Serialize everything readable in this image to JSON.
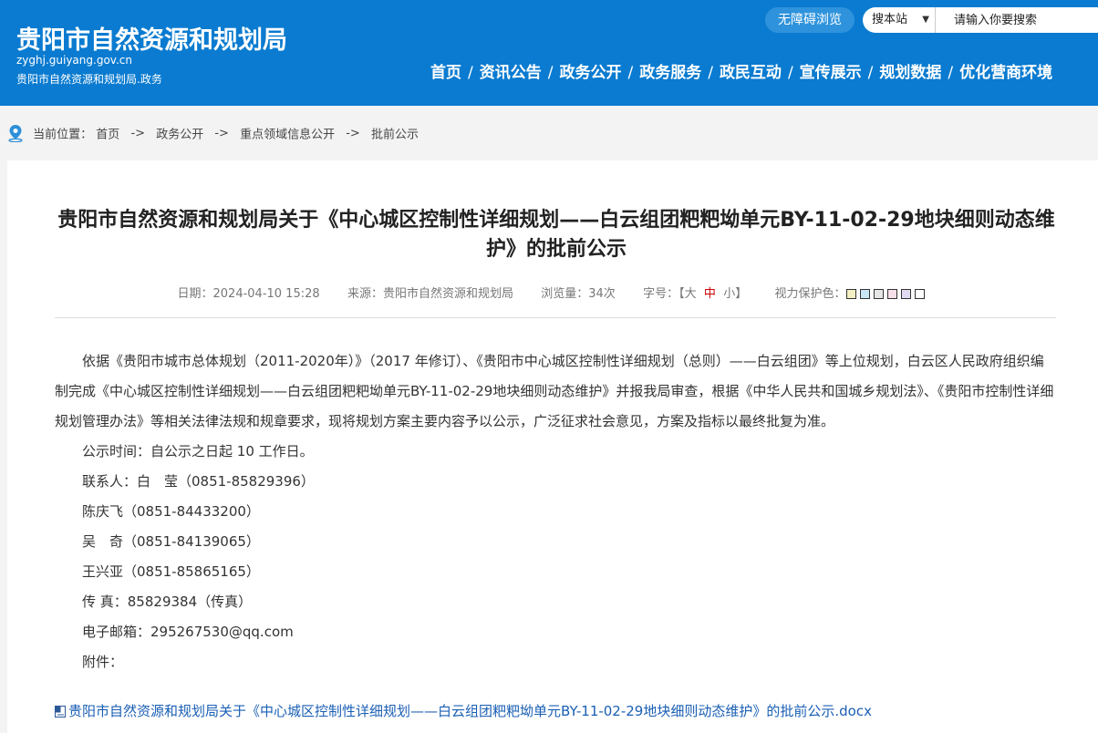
{
  "header": {
    "site_name": "贵阳市自然资源和规划局",
    "domain": "zyghj.guiyang.gov.cn",
    "suffix": "贵阳市自然资源和规划局.政务",
    "accessibility_label": "无障碍浏览",
    "search": {
      "scope": "搜本站",
      "placeholder": "请输入你要搜索"
    },
    "nav": [
      "首页",
      "资讯公告",
      "政务公开",
      "政务服务",
      "政民互动",
      "宣传展示",
      "规划数据",
      "优化营商环境"
    ],
    "colors": {
      "header_bg": "#0a7bd0",
      "accessibility_bg": "#2e93dc"
    }
  },
  "breadcrumb": {
    "prefix": "当前位置：",
    "items": [
      "首页",
      "政务公开",
      "重点领域信息公开",
      "批前公示"
    ],
    "separator": "->"
  },
  "article": {
    "title": "贵阳市自然资源和规划局关于《中心城区控制性详细规划——白云组团粑粑坳单元BY-11-02-29地块细则动态维护》的批前公示",
    "meta": {
      "date_label": "日期：",
      "date": "2024-04-10 15:28",
      "source_label": "来源：",
      "source": "贵阳市自然资源和规划局",
      "views_label": "浏览量：",
      "views": "34次",
      "font_label": "字号：",
      "font_open": "【",
      "font_large": "大",
      "font_medium": "中",
      "font_small": "小",
      "font_close": "】",
      "eye_label": "视力保护色：",
      "eye_colors": [
        "#f5efc4",
        "#c8e6f4",
        "#e6e6e6",
        "#f6dfe8",
        "#e2daf2",
        "#ffffff"
      ]
    },
    "body_paragraph": "依据《贵阳市城市总体规划（2011-2020年）》（2017 年修订）、《贵阳市中心城区控制性详细规划（总则）——白云组团》等上位规划，白云区人民政府组织编制完成《中心城区控制性详细规划——白云组团粑粑坳单元BY-11-02-29地块细则动态维护》并报我局审查，根据《中华人民共和国城乡规划法》、《贵阳市控制性详细规划管理办法》等相关法律法规和规章要求，现将规划方案主要内容予以公示，广泛征求社会意见，方案及指标以最终批复为准。",
    "lines": [
      "公示时间：自公示之日起 10 工作日。",
      "联系人：白　莹（0851-85829396）",
      "陈庆飞（0851-84433200）",
      "吴　奇（0851-84139065）",
      "王兴亚（0851-85865165）",
      "传 真：85829384（传真）",
      "电子邮箱：295267530@qq.com",
      "附件："
    ],
    "attachment": "贵阳市自然资源和规划局关于《中心城区控制性详细规划——白云组团粑粑坳单元BY-11-02-29地块细则动态维护》的批前公示.docx"
  }
}
